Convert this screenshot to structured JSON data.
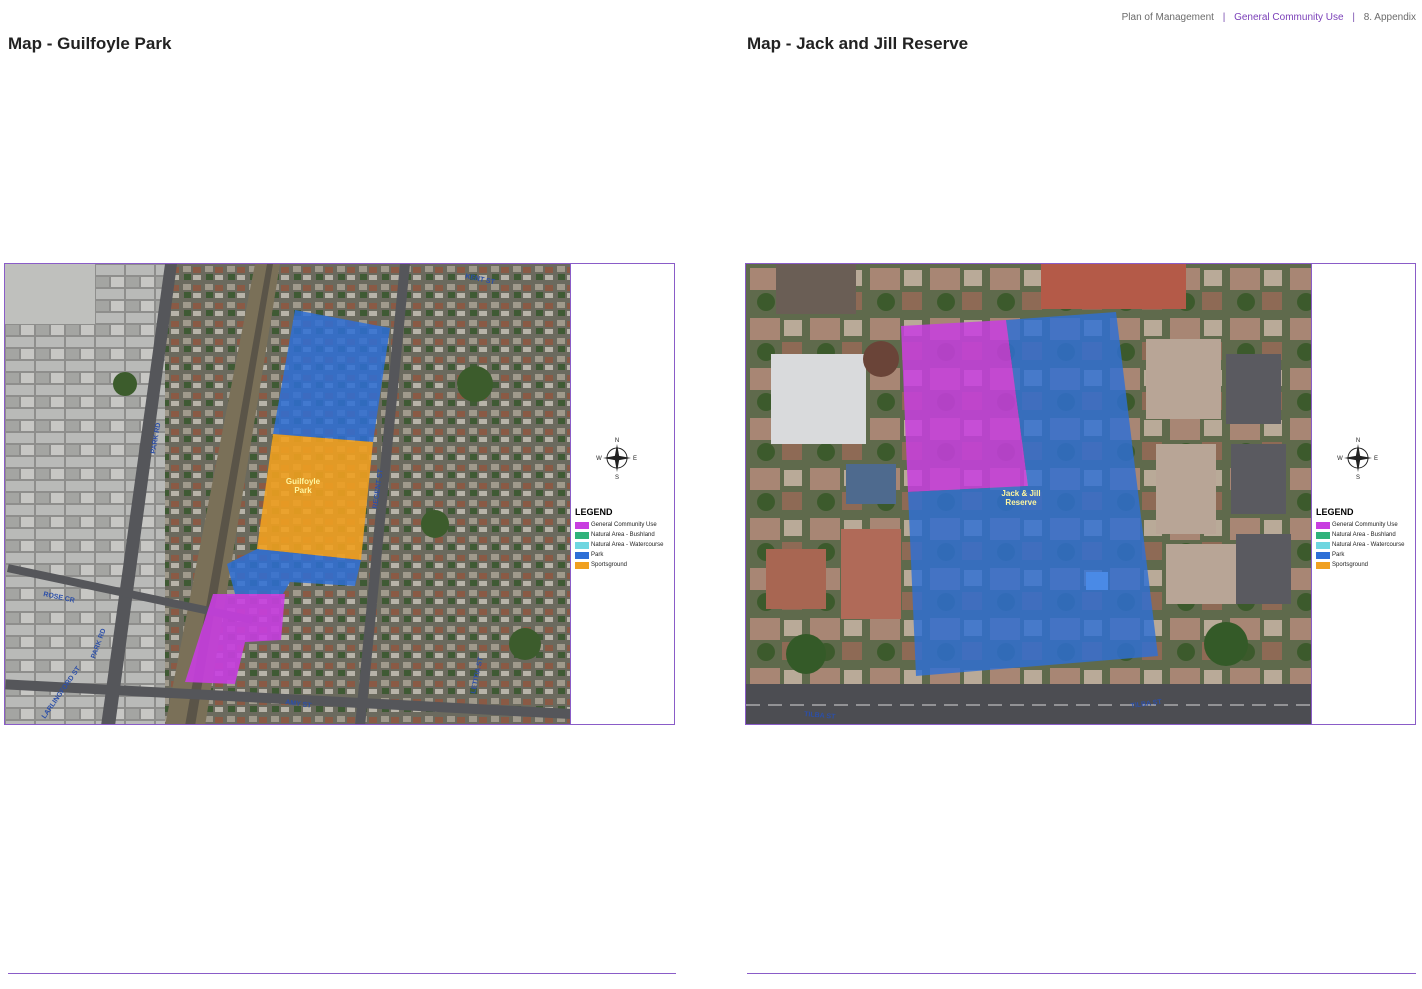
{
  "header": {
    "doc_title": "Plan of Management",
    "section": "General Community Use",
    "chapter": "8. Appendix"
  },
  "left_page": {
    "title": "Map - Guilfoyle Park",
    "park_label_line1": "Guilfoyle",
    "park_label_line2": "Park",
    "streets": [
      "KENT ST",
      "PARK RD",
      "REGENT ST",
      "ROSE CR",
      "PARK RD",
      "LARLINGFORD ST",
      "LETITIA ST",
      "AMY ST"
    ],
    "legend": {
      "title": "LEGEND",
      "items": [
        {
          "label": "General Community Use",
          "color": "#c83ee0"
        },
        {
          "label": "Natural Area - Bushland",
          "color": "#2fb27a"
        },
        {
          "label": "Natural Area - Watercourse",
          "color": "#6fd6e0"
        },
        {
          "label": "Park",
          "color": "#2e6fd6"
        },
        {
          "label": "Sportsground",
          "color": "#f0a020"
        }
      ]
    },
    "compass": {
      "n": "N",
      "s": "S",
      "e": "E",
      "w": "W"
    },
    "page_number": ""
  },
  "right_page": {
    "title": "Map - Jack and Jill Reserve",
    "park_label_line1": "Jack & Jill",
    "park_label_line2": "Reserve",
    "streets": [
      "TILBA ST",
      "TILBA ST"
    ],
    "legend": {
      "title": "LEGEND",
      "items": [
        {
          "label": "General Community Use",
          "color": "#c83ee0"
        },
        {
          "label": "Natural Area - Bushland",
          "color": "#2fb27a"
        },
        {
          "label": "Natural Area - Watercourse",
          "color": "#6fd6e0"
        },
        {
          "label": "Park",
          "color": "#2e6fd6"
        },
        {
          "label": "Sportsground",
          "color": "#f0a020"
        }
      ]
    },
    "compass": {
      "n": "N",
      "s": "S",
      "e": "E",
      "w": "W"
    },
    "page_number": ""
  }
}
